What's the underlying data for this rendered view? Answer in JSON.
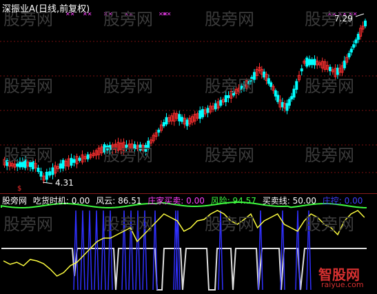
{
  "title": "深振业A(日线,前复权)",
  "watermark": "股旁网",
  "price_labels": {
    "high": "7.29",
    "low": "4.31"
  },
  "indicator": {
    "name": "股旁网",
    "items": [
      {
        "label": "吃货时机: 0.00",
        "color": "#ffffff"
      },
      {
        "label": "风云: 86.51",
        "color": "#ffffff"
      },
      {
        "label": "庄家买卖: 0.00",
        "color": "#ff40ff"
      },
      {
        "label": "风险: 94.57",
        "color": "#40ff40"
      },
      {
        "label": "买卖线: 50.00",
        "color": "#ffffff"
      },
      {
        "label": "庄控: 0.00",
        "color": "#4040ff"
      }
    ]
  },
  "logo": {
    "text": "智股网",
    "sub": "raiyue.com"
  },
  "colors": {
    "up": "#ff3030",
    "down": "#00ffff",
    "bg": "#000000",
    "grid": "#7a1010"
  }
}
